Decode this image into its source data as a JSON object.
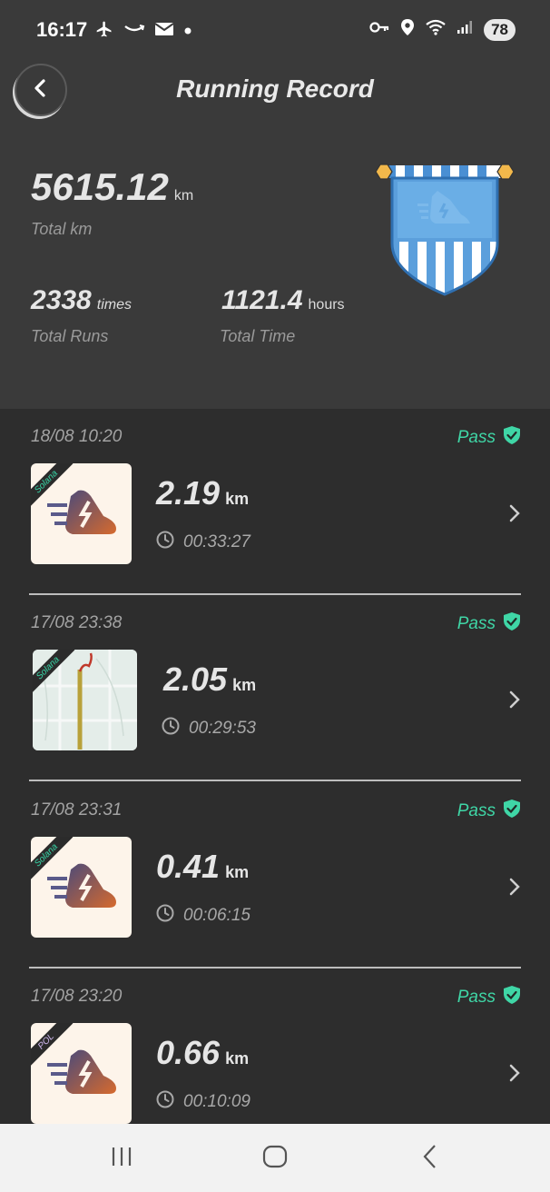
{
  "status": {
    "time": "16:17",
    "battery": "78",
    "left_icons": [
      "airplane-icon",
      "amazon-icon",
      "gmail-icon",
      "dot-icon"
    ],
    "right_icons": [
      "key-icon",
      "location-icon",
      "wifi-icon",
      "signal-icon"
    ]
  },
  "header": {
    "title": "Running Record",
    "total_km_value": "5615.12",
    "total_km_unit": "km",
    "total_km_label": "Total km",
    "total_runs_value": "2338",
    "total_runs_unit": "times",
    "total_runs_label": "Total Runs",
    "total_time_value": "1121.4",
    "total_time_unit": "hours",
    "total_time_label": "Total Time"
  },
  "records": [
    {
      "date": "18/08 10:20",
      "status": "Pass",
      "chain": "Solana",
      "distance": "2.19",
      "unit": "km",
      "duration": "00:33:27",
      "thumb": "shoe"
    },
    {
      "date": "17/08 23:38",
      "status": "Pass",
      "chain": "Solana",
      "distance": "2.05",
      "unit": "km",
      "duration": "00:29:53",
      "thumb": "map"
    },
    {
      "date": "17/08 23:31",
      "status": "Pass",
      "chain": "Solana",
      "distance": "0.41",
      "unit": "km",
      "duration": "00:06:15",
      "thumb": "shoe"
    },
    {
      "date": "17/08 23:20",
      "status": "Pass",
      "chain": "POL",
      "distance": "0.66",
      "unit": "km",
      "duration": "00:10:09",
      "thumb": "shoe"
    }
  ],
  "colors": {
    "header_bg": "#3a3a3a",
    "list_bg": "#2d2d2d",
    "pass_green": "#3fd6a6",
    "pennant_blue": "#5b9fdc"
  }
}
